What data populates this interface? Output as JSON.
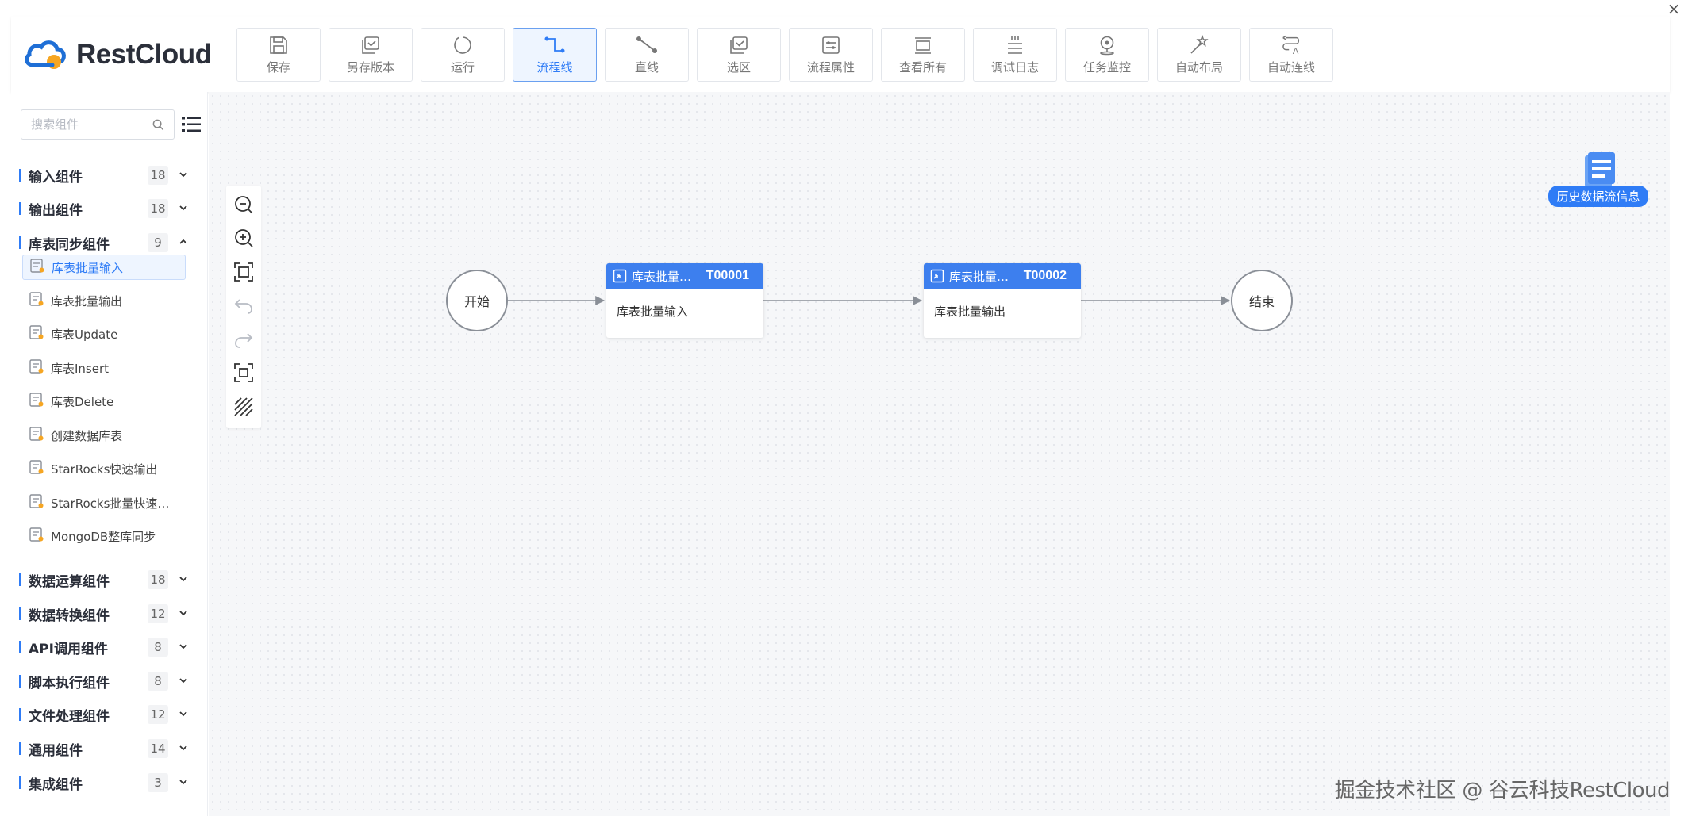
{
  "app": {
    "logo_text": "RestCloud",
    "close_label": "×"
  },
  "toolbar": [
    {
      "key": "save",
      "label": "保存",
      "icon": "floppy-icon",
      "active": false
    },
    {
      "key": "save-version",
      "label": "另存版本",
      "icon": "copy-check-icon",
      "active": false
    },
    {
      "key": "run",
      "label": "运行",
      "icon": "loading-circle-icon",
      "active": false
    },
    {
      "key": "flowline",
      "label": "流程线",
      "icon": "flowline-icon",
      "active": true
    },
    {
      "key": "straight",
      "label": "直线",
      "icon": "straight-line-icon",
      "active": false
    },
    {
      "key": "select-area",
      "label": "选区",
      "icon": "select-area-icon",
      "active": false
    },
    {
      "key": "flow-props",
      "label": "流程属性",
      "icon": "sliders-icon",
      "active": false
    },
    {
      "key": "view-all",
      "label": "查看所有",
      "icon": "view-all-icon",
      "active": false
    },
    {
      "key": "debug-log",
      "label": "调试日志",
      "icon": "log-lines-icon",
      "active": false
    },
    {
      "key": "task-monitor",
      "label": "任务监控",
      "icon": "location-pin-icon",
      "active": false
    },
    {
      "key": "auto-layout",
      "label": "自动布局",
      "icon": "magic-wand-icon",
      "active": false
    },
    {
      "key": "auto-connect",
      "label": "自动连线",
      "icon": "auto-connect-icon",
      "active": false
    }
  ],
  "sidebar": {
    "search_placeholder": "搜索组件",
    "groups": [
      {
        "name": "输入组件",
        "count": "18",
        "expanded": false
      },
      {
        "name": "输出组件",
        "count": "18",
        "expanded": false
      },
      {
        "name": "库表同步组件",
        "count": "9",
        "expanded": true
      },
      {
        "name": "数据运算组件",
        "count": "18",
        "expanded": false
      },
      {
        "name": "数据转换组件",
        "count": "12",
        "expanded": false
      },
      {
        "name": "API调用组件",
        "count": "8",
        "expanded": false
      },
      {
        "name": "脚本执行组件",
        "count": "8",
        "expanded": false
      },
      {
        "name": "文件处理组件",
        "count": "12",
        "expanded": false
      },
      {
        "name": "通用组件",
        "count": "14",
        "expanded": false
      },
      {
        "name": "集成组件",
        "count": "3",
        "expanded": false
      }
    ],
    "components": [
      {
        "name": "库表批量输入",
        "selected": true
      },
      {
        "name": "库表批量输出",
        "selected": false
      },
      {
        "name": "库表Update",
        "selected": false
      },
      {
        "name": "库表Insert",
        "selected": false
      },
      {
        "name": "库表Delete",
        "selected": false
      },
      {
        "name": "创建数据库表",
        "selected": false
      },
      {
        "name": "StarRocks快速输出",
        "selected": false
      },
      {
        "name": "StarRocks批量快速…",
        "selected": false
      },
      {
        "name": "MongoDB整库同步",
        "selected": false
      }
    ]
  },
  "canvas": {
    "start_label": "开始",
    "end_label": "结束",
    "nodes": [
      {
        "title": "库表批量…",
        "id": "T00001",
        "body": "库表批量输入"
      },
      {
        "title": "库表批量…",
        "id": "T00002",
        "body": "库表批量输出"
      }
    ],
    "history_label": "历史数据流信息"
  },
  "watermark": "掘金技术社区 @ 谷云科技RestCloud",
  "colors": {
    "accent": "#2f7cf6",
    "node_header": "#3d7fee",
    "logo_blue": "#1f6fd6",
    "logo_orange": "#f6a623"
  }
}
